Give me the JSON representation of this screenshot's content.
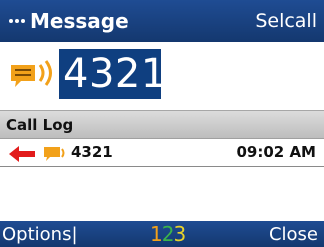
{
  "titlebar": {
    "icon": "dots-indicator-icon",
    "title": "Message",
    "right_label": "Selcall"
  },
  "entry": {
    "icon": "message-envelope-icon",
    "number": "4321"
  },
  "call_log": {
    "header": "Call Log",
    "entries": [
      {
        "direction_icon": "outgoing-arrow-icon",
        "type_icon": "message-icon",
        "number": "4321",
        "time": "09:02 AM"
      }
    ]
  },
  "softkeys": {
    "left": "Options|",
    "center_digits": [
      "1",
      "2",
      "3"
    ],
    "right": "Close"
  },
  "colors": {
    "bar_blue": "#1f4c93",
    "selection_blue": "#0f3f80",
    "arrow_red": "#e21b1b",
    "icon_orange": "#f2a11a"
  }
}
